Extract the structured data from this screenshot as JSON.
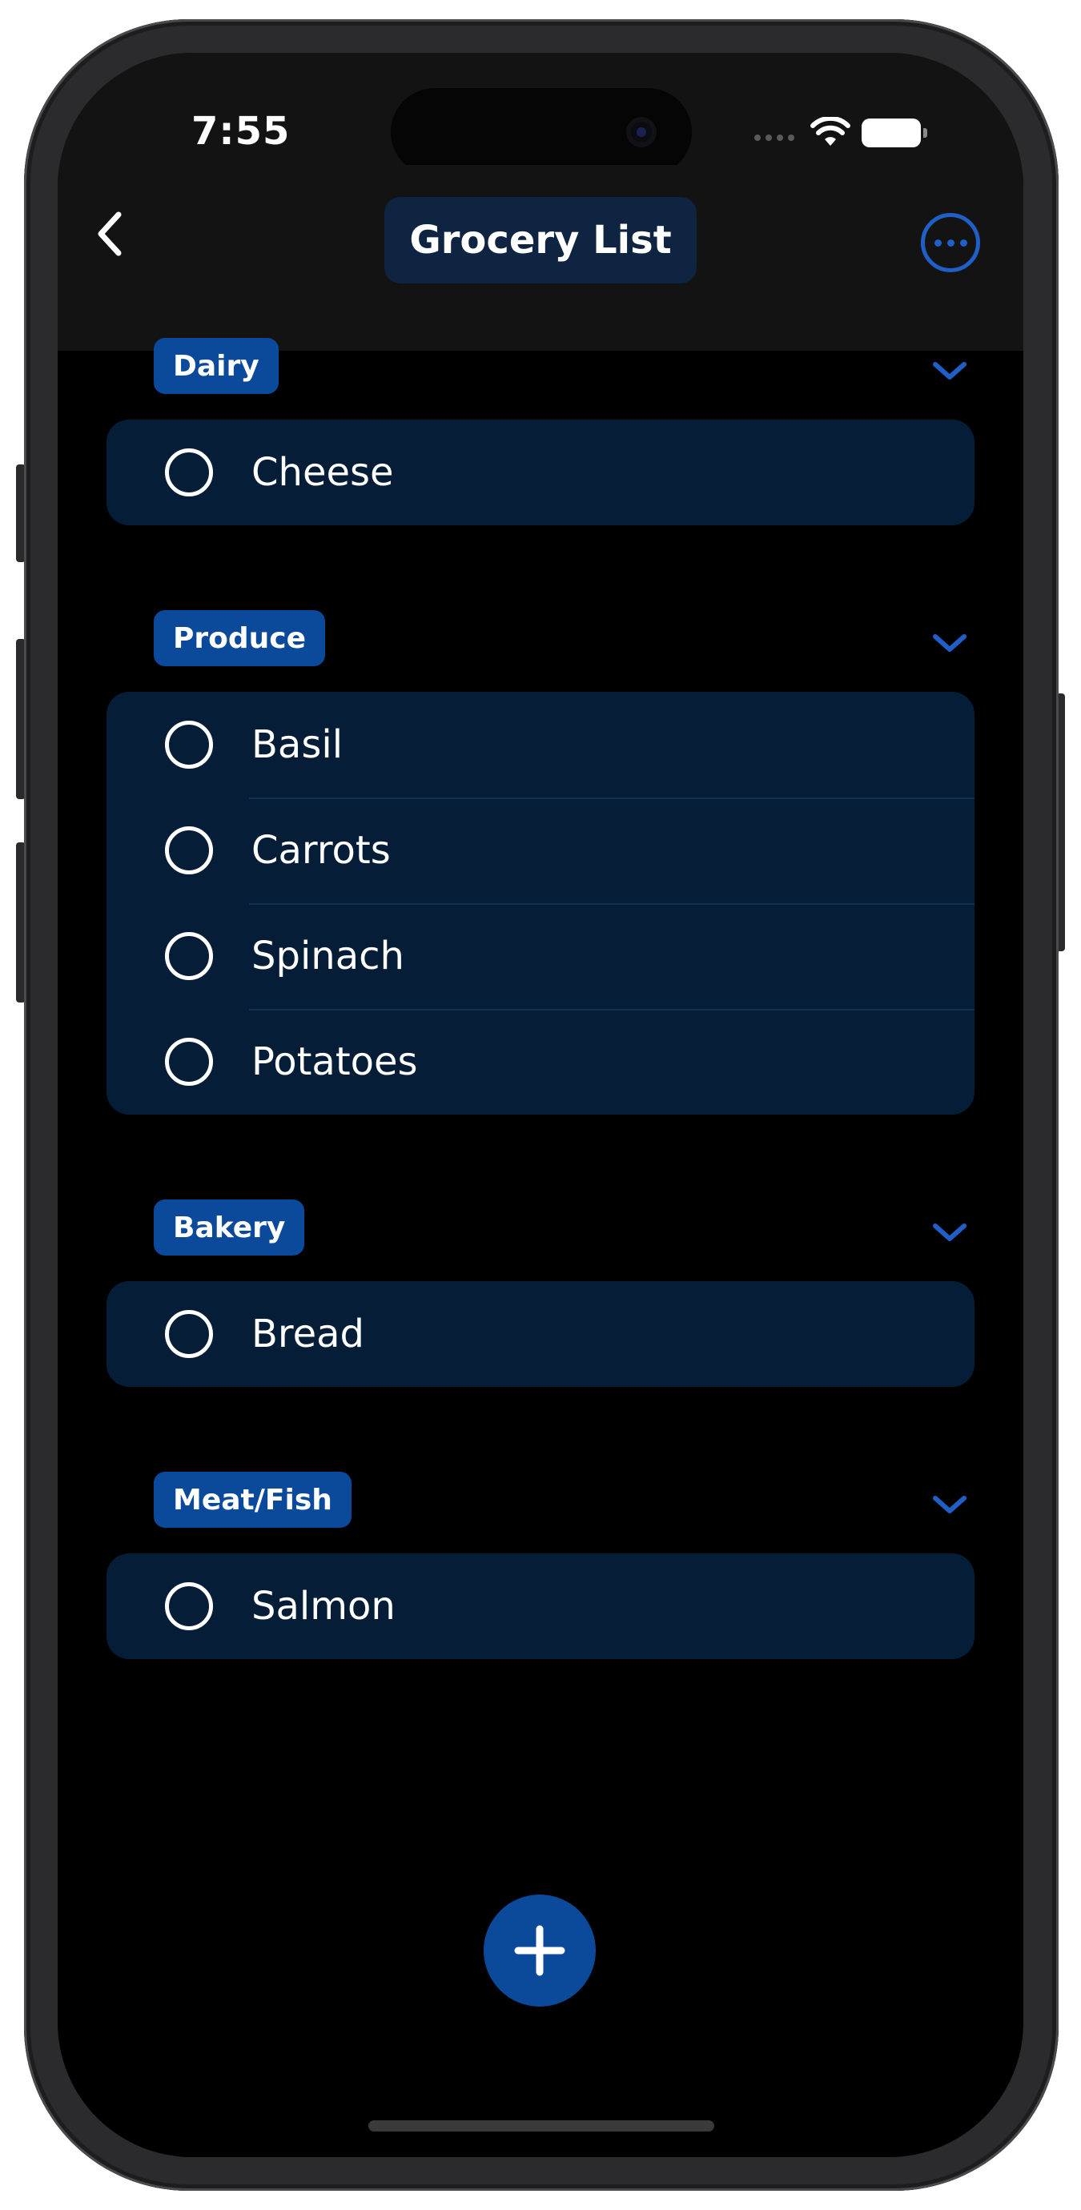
{
  "status_bar": {
    "time": "7:55",
    "icons": [
      "cellular-dots-icon",
      "wifi-icon",
      "battery-icon"
    ]
  },
  "nav": {
    "title": "Grocery List",
    "back_icon": "chevron-left-icon",
    "more_icon": "ellipsis-circle-icon"
  },
  "colors": {
    "accent": "#0b4a9a",
    "accent_bright": "#1f5fc6",
    "card_bg": "#051d36",
    "nav_bg": "#131313",
    "title_pill_bg": "#0e2441",
    "background": "#000000"
  },
  "sections": [
    {
      "name": "Dairy",
      "items": [
        "Cheese"
      ]
    },
    {
      "name": "Produce",
      "items": [
        "Basil",
        "Carrots",
        "Spinach",
        "Potatoes"
      ]
    },
    {
      "name": "Bakery",
      "items": [
        "Bread"
      ]
    },
    {
      "name": "Meat/Fish",
      "items": [
        "Salmon"
      ]
    }
  ],
  "add_button_icon": "plus-icon"
}
